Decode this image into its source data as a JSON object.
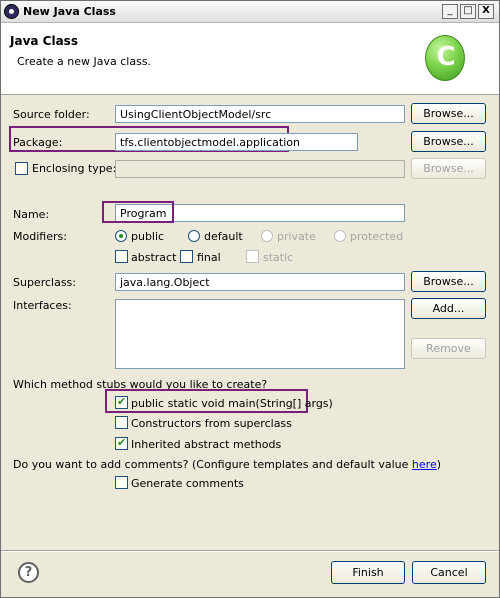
{
  "window": {
    "title": "New Java Class",
    "minimize": "_",
    "maximize": "□",
    "close": "X"
  },
  "header": {
    "title": "Java Class",
    "description": "Create a new Java class.",
    "logo_letter": "C",
    "logo_color": "#6cc644"
  },
  "form": {
    "source_folder": {
      "label": "Source folder:",
      "value": "UsingClientObjectModel/src",
      "browse": "Browse..."
    },
    "package": {
      "label": "Package:",
      "value": "tfs.clientobjectmodel.application",
      "browse": "Browse..."
    },
    "enclosing_type": {
      "label": "Enclosing type:",
      "value": "",
      "browse": "Browse...",
      "checked": false
    },
    "name": {
      "label": "Name:",
      "value": "Program"
    },
    "modifiers": {
      "label": "Modifiers:",
      "public": "public",
      "default": "default",
      "private": "private",
      "protected": "protected",
      "abstract": "abstract",
      "final": "final",
      "static": "static",
      "selected": "public"
    },
    "superclass": {
      "label": "Superclass:",
      "value": "java.lang.Object",
      "browse": "Browse..."
    },
    "interfaces": {
      "label": "Interfaces:",
      "add": "Add...",
      "remove": "Remove",
      "items": []
    },
    "stubs": {
      "question": "Which method stubs would you like to create?",
      "main": "public static void main(String[] args)",
      "constructors": "Constructors from superclass",
      "inherited": "Inherited abstract methods",
      "main_checked": true,
      "constructors_checked": false,
      "inherited_checked": true
    },
    "comments": {
      "question_prefix": "Do you want to add comments? (Configure templates and default value ",
      "link": "here",
      "question_suffix": ")",
      "generate": "Generate comments",
      "generate_checked": false
    }
  },
  "footer": {
    "help": "?",
    "finish": "Finish",
    "cancel": "Cancel"
  },
  "colors": {
    "highlight": "#7a1f7a",
    "check": "#2a8a22"
  }
}
